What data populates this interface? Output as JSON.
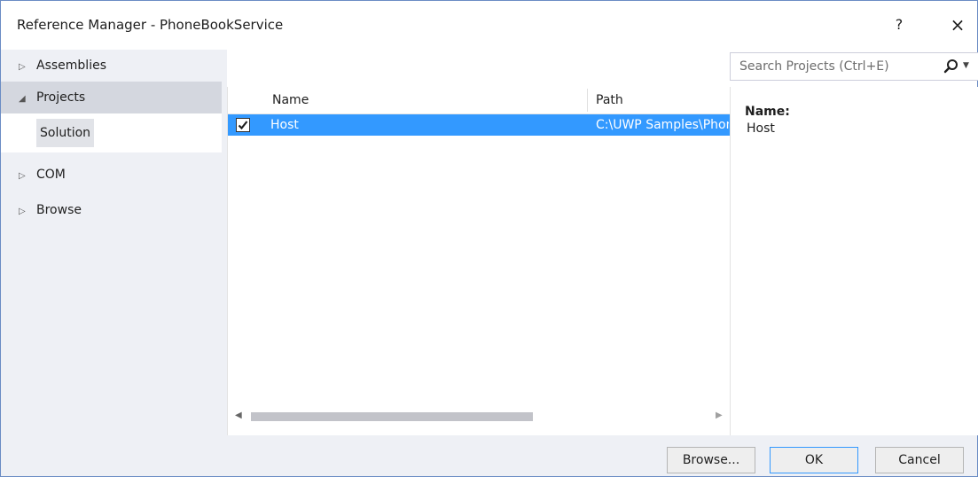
{
  "window": {
    "title": "Reference Manager - PhoneBookService",
    "help_label": "?",
    "close_label": "×"
  },
  "nav": {
    "items": [
      {
        "label": "Assemblies",
        "arrow": "▷"
      },
      {
        "label": "Projects",
        "arrow": "◢"
      },
      {
        "label": "COM",
        "arrow": "▷"
      },
      {
        "label": "Browse",
        "arrow": "▷"
      }
    ],
    "sub_item": {
      "label": "Solution"
    }
  },
  "search": {
    "placeholder": "Search Projects (Ctrl+E)",
    "dropdown_glyph": "▼"
  },
  "grid": {
    "columns": [
      {
        "label": "Name"
      },
      {
        "label": "Path"
      }
    ],
    "rows": [
      {
        "checked": true,
        "name": "Host",
        "path": "C:\\UWP Samples\\PhoneBook\\Host"
      }
    ]
  },
  "scrollbar": {
    "left_arrow": "◀",
    "right_arrow": "▶"
  },
  "details": {
    "name_label": "Name:",
    "name_value": "Host"
  },
  "buttons": {
    "browse": "Browse...",
    "ok": "OK",
    "cancel": "Cancel"
  },
  "colors": {
    "selection": "#3399ff",
    "nav_background": "#eef0f5",
    "nav_selected": "#d4d7df",
    "border_accent": "#6a8cc4"
  },
  "icons": {
    "search": "search-icon",
    "check": "check-icon",
    "help": "help-icon",
    "close": "close-icon"
  }
}
